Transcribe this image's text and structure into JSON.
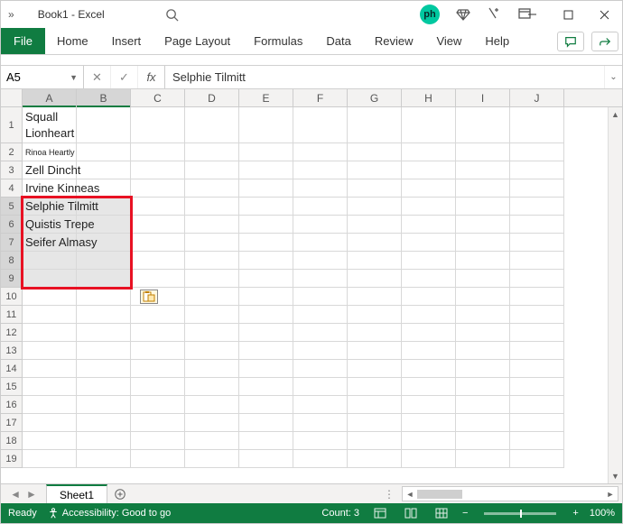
{
  "window": {
    "title": "Book1 - Excel"
  },
  "ribbon": {
    "file": "File",
    "tabs": [
      "Home",
      "Insert",
      "Page Layout",
      "Formulas",
      "Data",
      "Review",
      "View",
      "Help"
    ]
  },
  "name_box": "A5",
  "formula_bar": "Selphie Tilmitt",
  "columns": [
    "A",
    "B",
    "C",
    "D",
    "E",
    "F",
    "G",
    "H",
    "I",
    "J"
  ],
  "selected_cols": [
    "A",
    "B"
  ],
  "row_count": 19,
  "selected_rows": [
    5,
    6,
    7,
    8,
    9
  ],
  "tall_rows": [
    1
  ],
  "cells": {
    "r1": "Squall Lionheart",
    "r2": "Rinoa Heartly",
    "r3": "Zell Dincht",
    "r4": "Irvine Kinneas",
    "r5": "Selphie Tilmitt",
    "r6": "Quistis Trepe",
    "r7": "Seifer Almasy"
  },
  "sheet": {
    "active": "Sheet1"
  },
  "status": {
    "ready": "Ready",
    "accessibility": "Accessibility: Good to go",
    "count_label": "Count: 3",
    "zoom": "100%"
  }
}
